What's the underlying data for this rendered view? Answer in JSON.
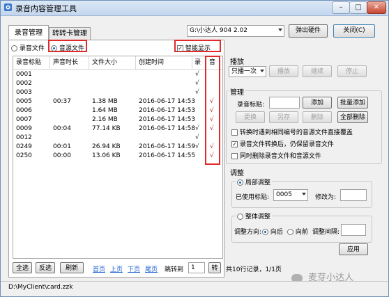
{
  "window": {
    "title": "录音内容管理工具"
  },
  "device_select": {
    "value": "G:\\小达人 904 2.02"
  },
  "top_buttons": {
    "eject": "弹出硬件",
    "close": "关闭(C)"
  },
  "tabs": [
    {
      "label": "录音管理"
    },
    {
      "label": "转转卡管理"
    }
  ],
  "filter": {
    "record_file": "录音文件",
    "source_file": "音源文件",
    "smart_display": "智能显示"
  },
  "table": {
    "columns": [
      "录音标贴",
      "声音时长",
      "文件大小",
      "创建时间",
      "录",
      "音"
    ],
    "rows": [
      {
        "tag": "0001",
        "duration": "",
        "size": "",
        "time": "",
        "rec": "√",
        "src": ""
      },
      {
        "tag": "0002",
        "duration": "",
        "size": "",
        "time": "",
        "rec": "√",
        "src": ""
      },
      {
        "tag": "0003",
        "duration": "",
        "size": "",
        "time": "",
        "rec": "√",
        "src": ""
      },
      {
        "tag": "0005",
        "duration": "00:37",
        "size": "1.38 MB",
        "time": "2016-06-17 14:53",
        "rec": "",
        "src": "√"
      },
      {
        "tag": "0006",
        "duration": "",
        "size": "1.64 MB",
        "time": "2016-06-17 14:53",
        "rec": "",
        "src": "√"
      },
      {
        "tag": "0007",
        "duration": "",
        "size": "2.16 MB",
        "time": "2016-06-17 14:53",
        "rec": "",
        "src": "√"
      },
      {
        "tag": "0009",
        "duration": "00:04",
        "size": "77.14 KB",
        "time": "2016-06-17 14:58",
        "rec": "√",
        "src": "√"
      },
      {
        "tag": "0012",
        "duration": "",
        "size": "",
        "time": "",
        "rec": "√",
        "src": ""
      },
      {
        "tag": "0249",
        "duration": "00:01",
        "size": "26.94 KB",
        "time": "2016-06-17 14:59",
        "rec": "√",
        "src": "√"
      },
      {
        "tag": "0250",
        "duration": "00:00",
        "size": "13.06 KB",
        "time": "2016-06-17 14:55",
        "rec": "",
        "src": "√"
      }
    ]
  },
  "bottom": {
    "select_all": "全选",
    "invert": "反选",
    "refresh": "刷新",
    "first": "首页",
    "prev": "上页",
    "next": "下页",
    "last": "尾页",
    "jump_label": "跳转到",
    "jump_value": "1",
    "go": "转",
    "summary": "共10行记录，1/1页"
  },
  "play": {
    "label": "播放",
    "mode": "只播一次",
    "play": "播放",
    "continue": "继续",
    "stop": "停止"
  },
  "manage": {
    "label": "管理",
    "tag_label": "录音标贴:",
    "add": "添加",
    "batch_add": "批量添加",
    "replace": "更换",
    "save_as": "另存",
    "delete": "删除",
    "delete_all": "全部删除",
    "opt1": "转换时遇到相同编号的音源文件直接覆盖",
    "opt2": "录音文件转换后，仍保留录音文件",
    "opt3": "同时删除录音文件和音源文件",
    "opt2_checked": true
  },
  "adjust": {
    "label": "调整",
    "local": "局部调整",
    "used_tag_label": "已使用标贴:",
    "used_tag_value": "0005",
    "modify_label": "修改为:",
    "whole": "整体调整",
    "direction_label": "调整方向:",
    "backward": "向后",
    "forward": "向前",
    "interval_label": "调整间隔:",
    "apply": "应用"
  },
  "status": {
    "path": "D:\\MyClient\\card.zzk"
  },
  "watermark": "麦芽小达人",
  "colors": {
    "highlight": "#e02a2a",
    "link": "#1a5fd0",
    "titlebar": "#c3d6ee"
  }
}
